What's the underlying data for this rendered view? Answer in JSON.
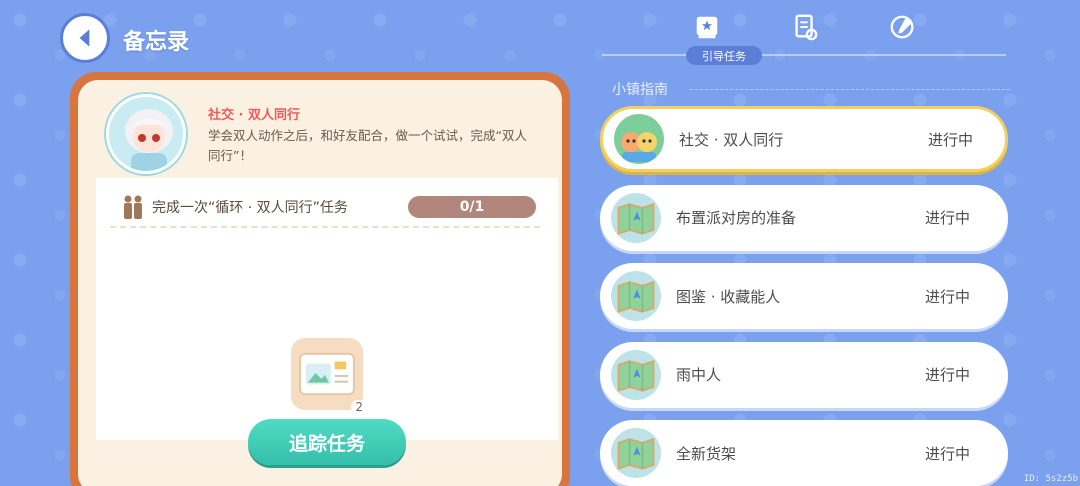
{
  "header": {
    "title": "备忘录"
  },
  "quest_detail": {
    "name": "社交 · 双人同行",
    "description": "学会双人动作之后，和好友配合，做一个试试，完成“双人同行”！",
    "goal": "完成一次“循环 · 双人同行”任务",
    "progress": "0/1",
    "reward_count": "2",
    "track_button": "追踪任务"
  },
  "tabs": {
    "active_label": "引导任务"
  },
  "section": {
    "label": "小镇指南"
  },
  "quests": [
    {
      "name": "社交 · 双人同行",
      "status": "进行中",
      "icon": "friends-icon"
    },
    {
      "name": "布置派对房的准备",
      "status": "进行中",
      "icon": "map-icon"
    },
    {
      "name": "图鉴 · 收藏能人",
      "status": "进行中",
      "icon": "map-icon"
    },
    {
      "name": "雨中人",
      "status": "进行中",
      "icon": "map-icon"
    },
    {
      "name": "全新货架",
      "status": "进行中",
      "icon": "map-icon"
    }
  ],
  "footer": {
    "id_text": "ID: 5s2z5b"
  }
}
